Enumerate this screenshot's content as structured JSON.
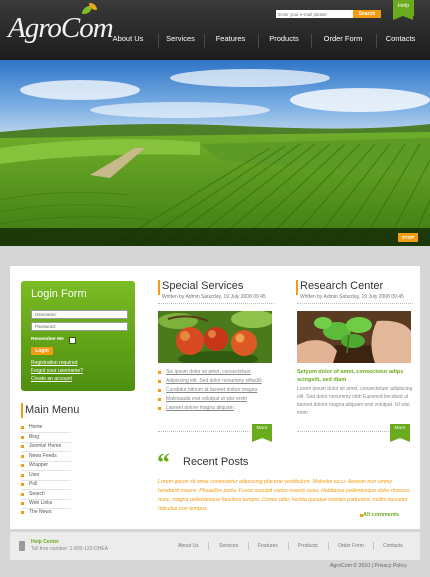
{
  "header": {
    "logo": "AgroCom",
    "search_placeholder": "Enter your e-mail please",
    "search_button": "Search",
    "help_tab": "Help",
    "nav": [
      {
        "label": "About Us"
      },
      {
        "label": "Services"
      },
      {
        "label": "Features"
      },
      {
        "label": "Products"
      },
      {
        "label": "Order Form"
      },
      {
        "label": "Contacts"
      }
    ]
  },
  "hero": {
    "stop_button": "STOP"
  },
  "login": {
    "title": "Login Form",
    "username_placeholder": "Username:",
    "password_placeholder": "Password:",
    "remember_label": "Remember Me",
    "login_button": "Login",
    "links": [
      "Registration required",
      "Forgot your username?",
      "Create an account"
    ]
  },
  "main_menu": {
    "title": "Main Menu",
    "items": [
      "Home",
      "Blog",
      "Joomla! Home",
      "News Feeds",
      "Wrapper",
      "User",
      "Poll",
      "Search",
      "Web Links",
      "The News"
    ]
  },
  "special_services": {
    "title": "Special Services",
    "byline": "Written by Admin Saturday, 19 July 2008 09:45",
    "list": [
      "Sie ipsum dolor sit amet, consectetuer",
      "Adipiscing elit. Sed dolor nonummy siftacilli",
      "Curabitur bitrium at laoreet dolore magna",
      "Malesuada erat volutpat ut wisi enim",
      "Laoreet dolore magna aliquam"
    ],
    "more_button": "More"
  },
  "research_center": {
    "title": "Research Center",
    "byline": "Written by Admin Saturday, 19 July 2008 09:45",
    "highlight": "Setyum dolor of amet, consectetur adips scingelit, sed diam",
    "text": "Lorem ipsum dolor sit amet, consectetuer adipiscing elit. Sed dolor nonummy nibh Euismod tincidunt ut laoreet dolore magna aliquam erat volutpat. Ut wisi enim",
    "more_button": "More"
  },
  "recent_posts": {
    "title": "Recent Posts",
    "text": "Lorem ipsum sit amet consectetur adipiscing placerat vestibulum. Molestie accu. Aenean non ummy hendrerit mauris. Phasellus porta. Fusce suscipit varius mauris ousu. Habitasse pellentesque dolor rhoncus nunc, magna pellentesque faucibus tempor. Donec odio, lacinia quisque montes parturient, mollis nascetur ridiculus non tempus.",
    "all_comments": "All comments"
  },
  "footer": {
    "help_title": "Help Center",
    "phone": "Toll free number: 1-800-123-DHEA",
    "links": [
      "About Us",
      "Services",
      "Features",
      "Products",
      "Order Form",
      "Contacts"
    ],
    "copyright": "AgroCom © 2010  |  Privacy Policy"
  },
  "colors": {
    "accent_green": "#6aab1d",
    "accent_orange": "#f39b12",
    "header_dark": "#262626",
    "page_bg": "#d6d6d6"
  }
}
